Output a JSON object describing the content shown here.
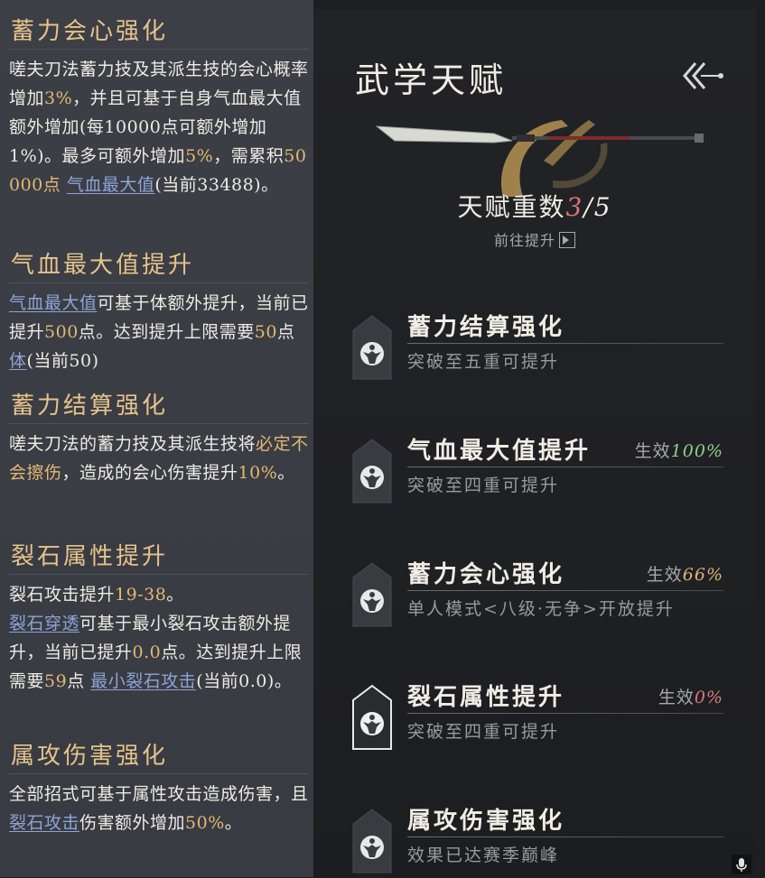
{
  "left_panel": {
    "sections": [
      {
        "title": "蓄力会心强化",
        "body": [
          {
            "t": "嗟夫刀法蓄力技及其派生技的会心概率增加"
          },
          {
            "t": "3%",
            "c": "hl"
          },
          {
            "t": "，并且可基于自身气血最大值额外增加(每10000点可额外增加1%)。最多可额外增加"
          },
          {
            "t": "5%",
            "c": "hl"
          },
          {
            "t": "，需累积"
          },
          {
            "t": "50000点",
            "c": "hl"
          },
          {
            "t": " "
          },
          {
            "t": "气血最大值",
            "c": "lnk"
          },
          {
            "t": "(当前33488)。"
          }
        ]
      },
      {
        "title": "气血最大值提升",
        "body": [
          {
            "t": "气血最大值",
            "c": "lnk"
          },
          {
            "t": "可基于体额外提升，当前已提升"
          },
          {
            "t": "500",
            "c": "hl"
          },
          {
            "t": "点。达到提升上限需要"
          },
          {
            "t": "50",
            "c": "hl"
          },
          {
            "t": "点"
          },
          {
            "t": "体",
            "c": "lnk"
          },
          {
            "t": "(当前50)"
          }
        ]
      },
      {
        "title": "蓄力结算强化",
        "body": [
          {
            "t": "嗟夫刀法的蓄力技及其派生技将"
          },
          {
            "t": "必定不会擦伤",
            "c": "hl"
          },
          {
            "t": "，造成的会心伤害提升"
          },
          {
            "t": "10%",
            "c": "hl"
          },
          {
            "t": "。"
          }
        ]
      },
      {
        "title": "裂石属性提升",
        "body": [
          {
            "t": "裂石攻击提升"
          },
          {
            "t": "19-38",
            "c": "hl"
          },
          {
            "t": "。"
          },
          {
            "br": true
          },
          {
            "t": "裂石穿透",
            "c": "lnk"
          },
          {
            "t": "可基于最小裂石攻击额外提升，当前已提升"
          },
          {
            "t": "0.0",
            "c": "hl"
          },
          {
            "t": "点。达到提升上限需要"
          },
          {
            "t": "59",
            "c": "hl"
          },
          {
            "t": "点 "
          },
          {
            "t": "最小裂石攻击",
            "c": "lnk"
          },
          {
            "t": "(当前0.0)。"
          }
        ]
      },
      {
        "title": "属攻伤害强化",
        "body": [
          {
            "t": "全部招式可基于属性攻击造成伤害，且"
          },
          {
            "t": "裂石攻击",
            "c": "lnk"
          },
          {
            "t": "伤害额外增加"
          },
          {
            "t": "50%",
            "c": "hl"
          },
          {
            "t": "。"
          }
        ]
      }
    ]
  },
  "right_panel": {
    "title": "武学天赋",
    "rank_label": "天赋重数",
    "rank_current": "3",
    "rank_max": "/5",
    "goto_label": "前往提升",
    "talents": [
      {
        "name": "蓄力结算强化",
        "sub": "突破至五重可提升",
        "eff_label": "",
        "eff_value": "",
        "eff_color": "",
        "badge": "dark"
      },
      {
        "name": "气血最大值提升",
        "sub": "突破至四重可提升",
        "eff_label": "生效",
        "eff_value": "100%",
        "eff_color": "g",
        "badge": "dark"
      },
      {
        "name": "蓄力会心强化",
        "sub": "单人模式<八级·无争>开放提升",
        "eff_label": "生效",
        "eff_value": "66%",
        "eff_color": "y",
        "badge": "dark"
      },
      {
        "name": "裂石属性提升",
        "sub": "突破至四重可提升",
        "eff_label": "生效",
        "eff_value": "0%",
        "eff_color": "r",
        "badge": "selected"
      },
      {
        "name": "属攻伤害强化",
        "sub": "效果已达赛季巅峰",
        "eff_label": "",
        "eff_value": "",
        "eff_color": "",
        "badge": "dark"
      }
    ],
    "icons": {
      "back": "double-chevron-left-icon",
      "talent_badge": "martial-figure-icon",
      "goto": "arrow-right-box-icon",
      "mic": "microphone-icon"
    }
  }
}
